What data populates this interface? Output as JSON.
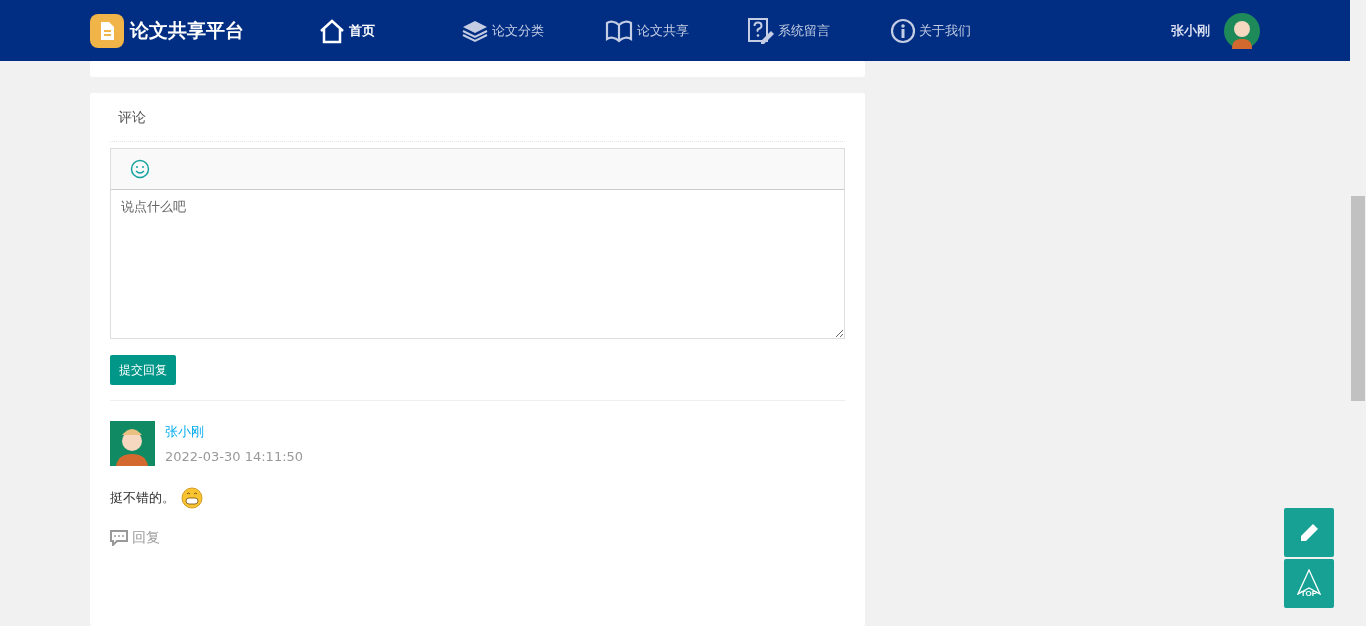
{
  "header": {
    "logo_text": "论文共享平台",
    "nav": [
      {
        "label": "首页",
        "selected": true
      },
      {
        "label": "论文分类",
        "selected": false
      },
      {
        "label": "论文共享",
        "selected": false
      },
      {
        "label": "系统留言",
        "selected": false
      },
      {
        "label": "关于我们",
        "selected": false
      }
    ],
    "user_name": "张小刚"
  },
  "comment_section": {
    "title": "评论",
    "editor": {
      "placeholder": "说点什么吧"
    },
    "submit_button": "提交回复",
    "comments": [
      {
        "author": "张小刚",
        "time": "2022-03-30 14:11:50",
        "text": "挺不错的。",
        "reply_label": "回复"
      }
    ]
  },
  "float_buttons": {
    "top_label": "TOP"
  }
}
